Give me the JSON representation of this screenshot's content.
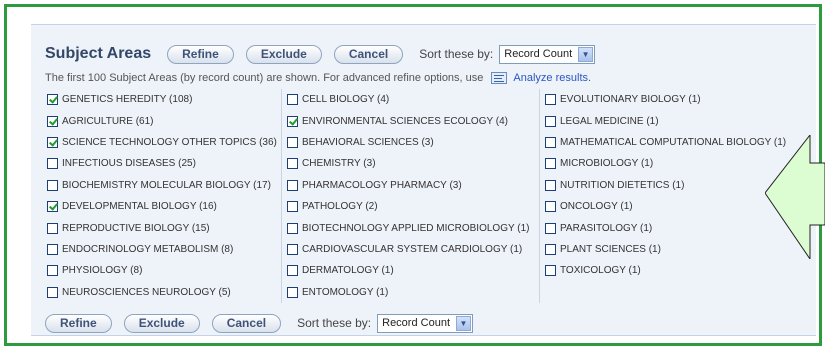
{
  "header": {
    "title": "Subject Areas",
    "refine_label": "Refine",
    "exclude_label": "Exclude",
    "cancel_label": "Cancel",
    "sort_label": "Sort these by:",
    "sort_value": "Record Count"
  },
  "info": {
    "text": "The first 100 Subject Areas (by record count) are shown. For advanced refine options, use",
    "link_text": "Analyze results",
    "period": "."
  },
  "columns": [
    [
      {
        "label": "GENETICS HEREDITY (108)",
        "checked": true
      },
      {
        "label": "AGRICULTURE (61)",
        "checked": true
      },
      {
        "label": "SCIENCE TECHNOLOGY OTHER TOPICS (36)",
        "checked": true
      },
      {
        "label": "INFECTIOUS DISEASES (25)",
        "checked": false
      },
      {
        "label": "BIOCHEMISTRY MOLECULAR BIOLOGY (17)",
        "checked": false
      },
      {
        "label": "DEVELOPMENTAL BIOLOGY (16)",
        "checked": true
      },
      {
        "label": "REPRODUCTIVE BIOLOGY (15)",
        "checked": false
      },
      {
        "label": "ENDOCRINOLOGY METABOLISM (8)",
        "checked": false
      },
      {
        "label": "PHYSIOLOGY (8)",
        "checked": false
      },
      {
        "label": "NEUROSCIENCES NEUROLOGY (5)",
        "checked": false
      }
    ],
    [
      {
        "label": "CELL BIOLOGY (4)",
        "checked": false
      },
      {
        "label": "ENVIRONMENTAL SCIENCES ECOLOGY (4)",
        "checked": true
      },
      {
        "label": "BEHAVIORAL SCIENCES (3)",
        "checked": false
      },
      {
        "label": "CHEMISTRY (3)",
        "checked": false
      },
      {
        "label": "PHARMACOLOGY PHARMACY (3)",
        "checked": false
      },
      {
        "label": "PATHOLOGY (2)",
        "checked": false
      },
      {
        "label": "BIOTECHNOLOGY APPLIED MICROBIOLOGY (1)",
        "checked": false
      },
      {
        "label": "CARDIOVASCULAR SYSTEM CARDIOLOGY (1)",
        "checked": false
      },
      {
        "label": "DERMATOLOGY (1)",
        "checked": false
      },
      {
        "label": "ENTOMOLOGY (1)",
        "checked": false
      }
    ],
    [
      {
        "label": "EVOLUTIONARY BIOLOGY (1)",
        "checked": false
      },
      {
        "label": "LEGAL MEDICINE (1)",
        "checked": false
      },
      {
        "label": "MATHEMATICAL COMPUTATIONAL BIOLOGY (1)",
        "checked": false
      },
      {
        "label": "MICROBIOLOGY (1)",
        "checked": false
      },
      {
        "label": "NUTRITION DIETETICS (1)",
        "checked": false
      },
      {
        "label": "ONCOLOGY (1)",
        "checked": false
      },
      {
        "label": "PARASITOLOGY (1)",
        "checked": false
      },
      {
        "label": "PLANT SCIENCES (1)",
        "checked": false
      },
      {
        "label": "TOXICOLOGY (1)",
        "checked": false
      }
    ]
  ],
  "footer": {
    "refine_label": "Refine",
    "exclude_label": "Exclude",
    "cancel_label": "Cancel",
    "sort_label": "Sort these by:",
    "sort_value": "Record Count"
  },
  "icons": {
    "checkbox_check": "check-icon",
    "dropdown": "chevron-down-icon",
    "analyze": "analyze-results-icon",
    "callout": "left-arrow-callout"
  },
  "colors": {
    "frame_border": "#2e9b3e",
    "panel_bg": "#eef3fa",
    "callout_fill": "#dcfcd2",
    "link": "#2a56c4"
  }
}
